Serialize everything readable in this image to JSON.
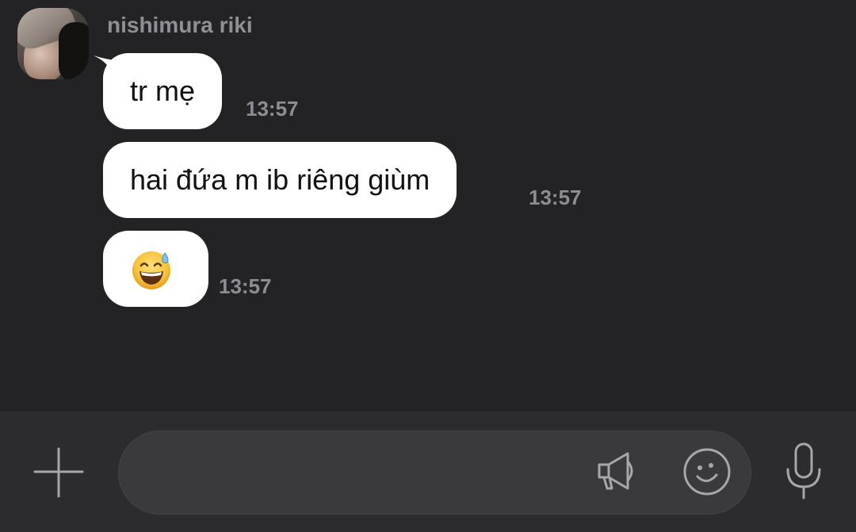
{
  "chat": {
    "sender_name": "nishimura riki",
    "messages": [
      {
        "text": "tr mẹ",
        "time": "13:57"
      },
      {
        "text": "hai đứa m ib riêng giùm",
        "time": "13:57"
      },
      {
        "text": "",
        "emoji": "grinning-face-with-sweat",
        "time": "13:57"
      }
    ]
  },
  "composer": {
    "placeholder": "",
    "value": ""
  },
  "icons": {
    "plus": "plus-icon",
    "megaphone": "megaphone-icon",
    "emoji": "smiley-icon",
    "microphone": "microphone-icon"
  },
  "colors": {
    "background": "#232326",
    "bubble": "#ffffff",
    "input_bar": "#2c2c2f",
    "input_field": "#3a3a3d",
    "muted_text": "#8d8d93"
  }
}
